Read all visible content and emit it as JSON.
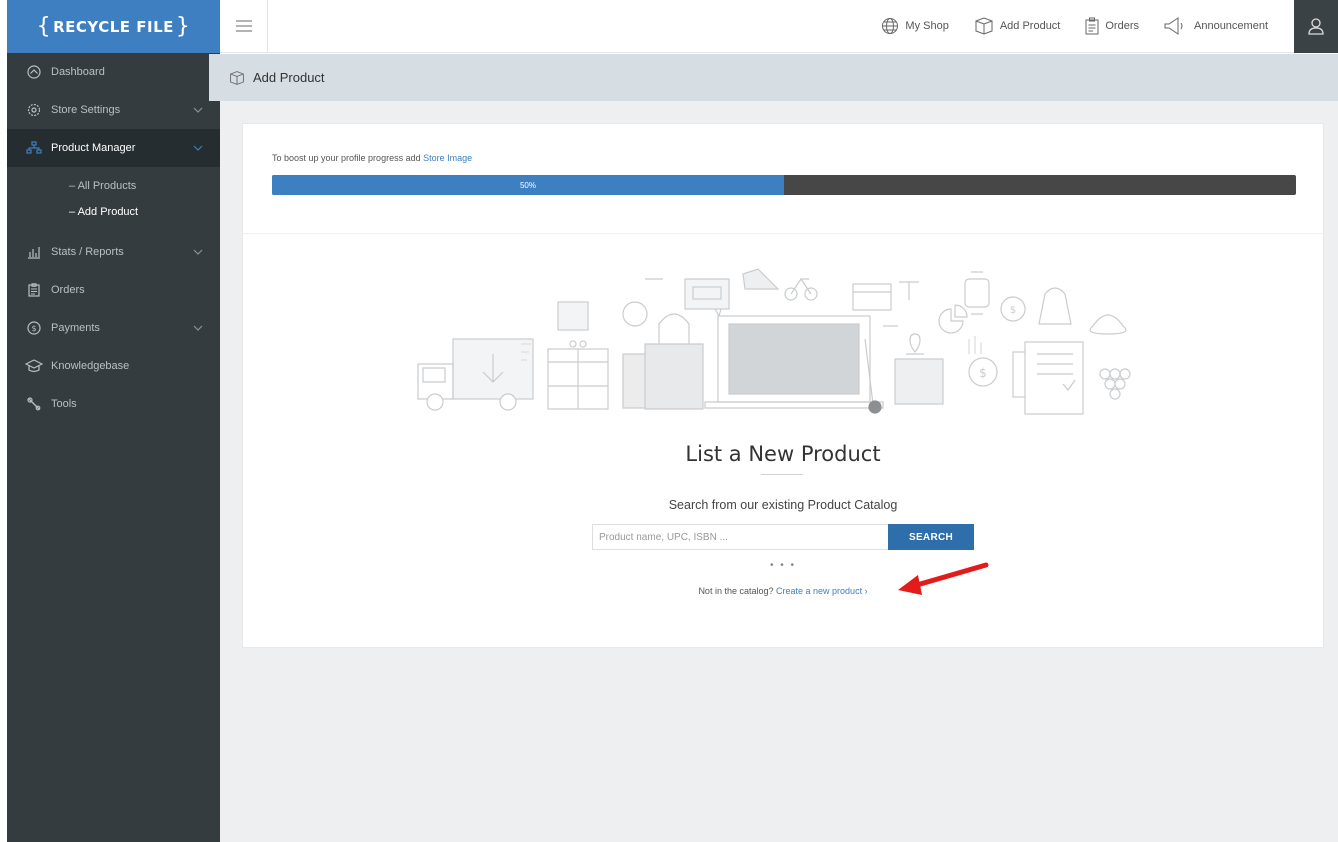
{
  "brand": {
    "logo_text": "RECYCLE FILE"
  },
  "sidebar": {
    "items": [
      {
        "label": "Dashboard",
        "icon": "dashboard-icon"
      },
      {
        "label": "Store Settings",
        "icon": "gear-icon"
      },
      {
        "label": "Product Manager",
        "icon": "sitemap-icon"
      },
      {
        "label": "Stats / Reports",
        "icon": "bar-chart-icon"
      },
      {
        "label": "Orders",
        "icon": "clipboard-icon"
      },
      {
        "label": "Payments",
        "icon": "dollar-icon"
      },
      {
        "label": "Knowledgebase",
        "icon": "graduation-cap-icon"
      },
      {
        "label": "Tools",
        "icon": "wrench-icon"
      }
    ],
    "product_manager_sub": [
      {
        "label": "– All Products"
      },
      {
        "label": "– Add Product"
      }
    ]
  },
  "topbar": {
    "links": [
      {
        "label": "My Shop",
        "icon": "globe-icon"
      },
      {
        "label": "Add Product",
        "icon": "box-icon"
      },
      {
        "label": "Orders",
        "icon": "clipboard-icon"
      },
      {
        "label": "Announcement",
        "icon": "megaphone-icon"
      }
    ]
  },
  "page_header": {
    "title": "Add Product"
  },
  "progress": {
    "prefix": "To boost up your profile progress add",
    "link": "Store Image",
    "percent_label": "50%",
    "value": 0.5
  },
  "main": {
    "title": "List a New Product",
    "subtitle": "Search from our existing Product Catalog",
    "search_placeholder": "Product name, UPC, ISBN ...",
    "search_button": "SEARCH",
    "dots": "• • •",
    "not_in_catalog": "Not in the catalog?",
    "create_link": "Create a new product ›"
  },
  "colors": {
    "sidebar_bg": "#343c3f",
    "brand_blue": "#3d7fc1",
    "button_blue": "#2e6eab",
    "progress_track": "#474747",
    "arrow_red": "#e41b1b"
  }
}
